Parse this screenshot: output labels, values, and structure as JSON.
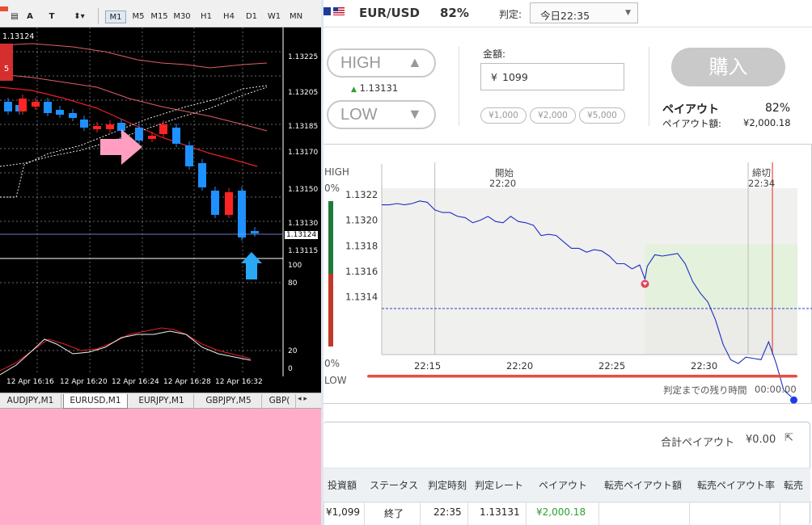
{
  "mt4": {
    "toolbar": {
      "timeframes": [
        "M1",
        "M5",
        "M15",
        "M30",
        "H1",
        "H4",
        "D1",
        "W1",
        "MN"
      ]
    },
    "chart": {
      "price_label": "1.13124",
      "trade_badge": "5",
      "price_axis": [
        "1.13225",
        "1.13205",
        "1.13185",
        "1.13170",
        "1.13150",
        "1.13130",
        "1.13124",
        "1.13115"
      ],
      "osc_axis": [
        "100",
        "80",
        "20",
        "0"
      ],
      "time_axis": [
        "12 Apr 16:16",
        "12 Apr 16:20",
        "12 Apr 16:24",
        "12 Apr 16:28",
        "12 Apr 16:32"
      ]
    },
    "tabs": [
      "AUDJPY,M1",
      "EURUSD,M1",
      "EURJPY,M1",
      "GBPJPY,M5",
      "GBP("
    ],
    "active_tab": 1
  },
  "trade": {
    "pair": "EUR/USD",
    "payout_rate": "82%",
    "judgement_label": "判定:",
    "judgement_value": "今日22:35",
    "high_label": "HIGH",
    "low_label": "LOW",
    "rate_arrow": "▲",
    "rate": "1.13131",
    "amount_label": "金額:",
    "amount_currency": "¥",
    "amount_value": "1099",
    "quick_amounts": [
      "¥1,000",
      "¥2,000",
      "¥5,000"
    ],
    "buy_label": "購入",
    "payout_title": "ペイアウト",
    "payout_title_rate": "82%",
    "payout_amount_label": "ペイアウト額:",
    "payout_amount": "¥2,000.18"
  },
  "chart_data": {
    "type": "line",
    "series": [
      {
        "values": [
          [
            0,
            1.13212
          ],
          [
            1,
            1.13212
          ],
          [
            2,
            1.13213
          ],
          [
            3,
            1.13212
          ],
          [
            4,
            1.13213
          ],
          [
            5,
            1.13215
          ],
          [
            6,
            1.13214
          ],
          [
            7,
            1.13208
          ],
          [
            8,
            1.13206
          ],
          [
            9,
            1.13206
          ],
          [
            10,
            1.13203
          ],
          [
            11,
            1.13202
          ],
          [
            12,
            1.13198
          ],
          [
            13,
            1.132
          ],
          [
            14,
            1.13203
          ],
          [
            15,
            1.13199
          ],
          [
            16,
            1.13198
          ],
          [
            17,
            1.13203
          ],
          [
            18,
            1.13199
          ],
          [
            19,
            1.13198
          ],
          [
            20,
            1.13196
          ],
          [
            21,
            1.13188
          ],
          [
            22,
            1.13189
          ],
          [
            23,
            1.13188
          ],
          [
            24,
            1.13183
          ],
          [
            25,
            1.13178
          ],
          [
            26,
            1.13178
          ],
          [
            27,
            1.13175
          ],
          [
            28,
            1.13177
          ],
          [
            29,
            1.13176
          ],
          [
            30,
            1.13172
          ],
          [
            31,
            1.13166
          ],
          [
            32,
            1.13166
          ],
          [
            33,
            1.13162
          ],
          [
            34,
            1.13165
          ],
          [
            34.7,
            1.13154
          ],
          [
            35,
            1.13164
          ],
          [
            36,
            1.13173
          ],
          [
            37,
            1.13172
          ],
          [
            38,
            1.13173
          ],
          [
            39,
            1.13174
          ],
          [
            40,
            1.13166
          ],
          [
            41,
            1.13152
          ],
          [
            42,
            1.13143
          ],
          [
            43,
            1.13136
          ],
          [
            44,
            1.13122
          ],
          [
            45,
            1.13103
          ],
          [
            46,
            1.13091
          ],
          [
            47,
            1.13088
          ],
          [
            48,
            1.13093
          ],
          [
            49,
            1.13092
          ],
          [
            50,
            1.13091
          ],
          [
            51,
            1.13105
          ],
          [
            52,
            1.13088
          ],
          [
            53,
            1.13067
          ],
          [
            54,
            1.13062
          ]
        ]
      }
    ],
    "x_unit": "minutes after 22:13",
    "x_ticks": [
      "22:15",
      "22:20",
      "22:25",
      "22:30"
    ],
    "y_ticks": [
      "1.1322",
      "1.1320",
      "1.1318",
      "1.1316",
      "1.1314"
    ],
    "ylim": [
      1.13095,
      1.13225
    ],
    "strike": 1.13131,
    "entry_x": 34.7,
    "start_label": [
      "開始",
      "22:20"
    ],
    "end_label": [
      "締切",
      "22:34"
    ],
    "side_labels": [
      "HIGH",
      "0%",
      "0%",
      "LOW"
    ],
    "remaining_label": "判定までの残り時間",
    "remaining_value": "00:00:00"
  },
  "history": {
    "total_label": "合計ペイアウト",
    "total_value": "¥0.00",
    "headers": [
      "投資額",
      "ステータス",
      "判定時刻",
      "判定レート",
      "ペイアウト",
      "転売ペイアウト額",
      "転売ペイアウト率",
      "転売"
    ],
    "row": [
      "¥1,099",
      "終了",
      "22:35",
      "1.13131",
      "¥2,000.18",
      "",
      "",
      ""
    ]
  },
  "colors": {
    "high": "#1f7a3a",
    "low": "#c0392b",
    "line": "#1c2fc2",
    "mt_up": "#ff2424",
    "mt_down": "#1e90ff",
    "payout_green": "#2ca02c"
  }
}
